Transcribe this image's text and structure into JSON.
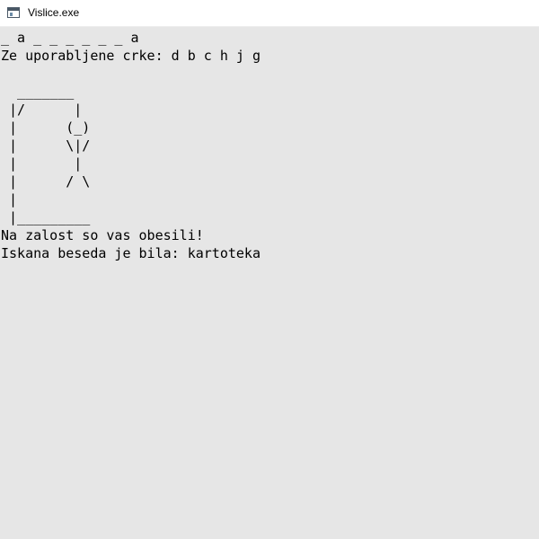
{
  "window": {
    "title": "Vislice.exe",
    "icon": "console-window-icon"
  },
  "console": {
    "lines": [
      "_ a _ _ _ _ _ _ a",
      "Ze uporabljene crke: d b c h j g",
      "",
      "  _______",
      " |/      |",
      " |      (_)",
      " |      \\|/",
      " |       |",
      " |      / \\",
      " |",
      " |_________",
      "Na zalost so vas obesili!",
      "Iskana beseda je bila: kartoteka"
    ]
  },
  "colors": {
    "console_background": "#e6e6e6",
    "titlebar_background": "#ffffff",
    "text": "#000000"
  }
}
